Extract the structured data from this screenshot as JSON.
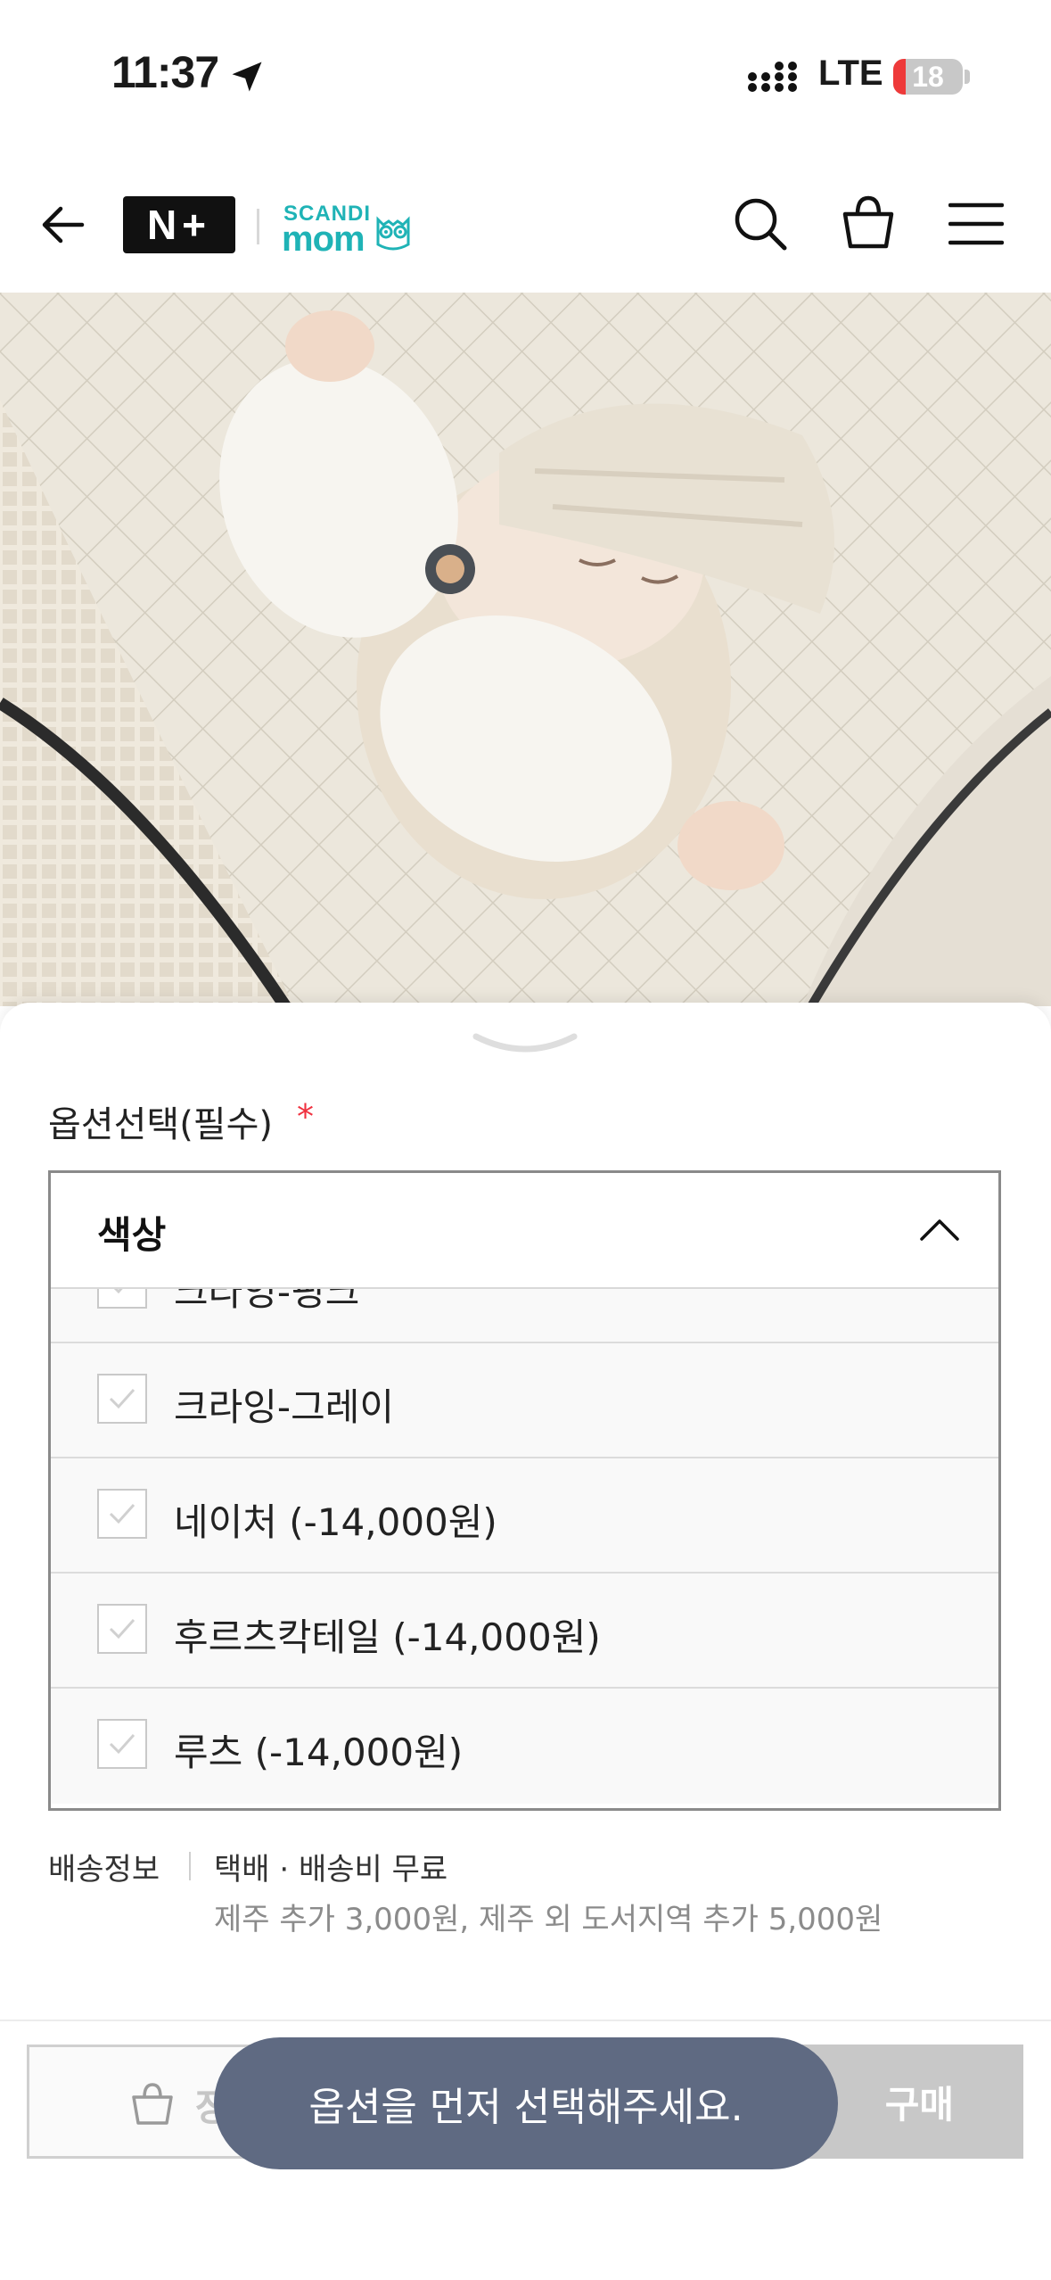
{
  "status_bar": {
    "time": "11:37",
    "network": "LTE",
    "battery_percent": 18
  },
  "header": {
    "partner_logo": "N+",
    "brand_logo_top": "SCANDI",
    "brand_logo_bottom": "mom",
    "icons": [
      "back-arrow-icon",
      "search-icon",
      "shopping-bag-icon",
      "hamburger-menu-icon"
    ]
  },
  "options": {
    "title": "옵션선택(필수)",
    "required_mark": "*",
    "select_label": "색상",
    "items": [
      {
        "label": "크라잉-핑크"
      },
      {
        "label": "크라잉-그레이"
      },
      {
        "label": "네이처 (-14,000원)"
      },
      {
        "label": "후르츠칵테일 (-14,000원)"
      },
      {
        "label": "루츠 (-14,000원)"
      }
    ]
  },
  "delivery": {
    "label": "배송정보",
    "value": "택배 · 배송비 무료",
    "note": "제주 추가 3,000원, 제주 외 도서지역 추가 5,000원"
  },
  "actions": {
    "cart_label": "장",
    "buy_label": "구매"
  },
  "toast": {
    "message": "옵션을 먼저 선택해주세요."
  },
  "colors": {
    "brand": "#1fb3b6",
    "required": "#f0313f",
    "toast_bg": "#5f6a82",
    "battery_low": "#ee3a3a"
  }
}
